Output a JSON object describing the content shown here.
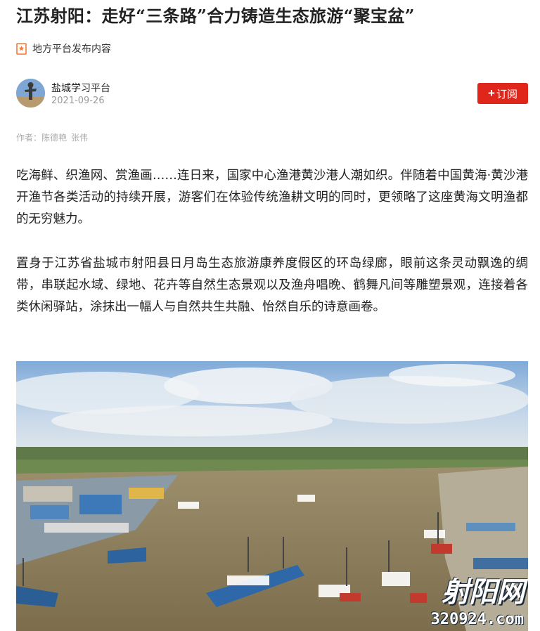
{
  "article": {
    "title": "江苏射阳：走好“三条路”合力铸造生态旅游“聚宝盆”",
    "source_label": "地方平台发布内容",
    "author": {
      "name": "盐城学习平台",
      "date": "2021-09-26",
      "subscribe_label": "订阅",
      "subscribe_plus": "+"
    },
    "byline": {
      "prefix": "作者：",
      "names": [
        "陈德艳",
        "张伟"
      ]
    },
    "paragraphs": [
      "吃海鲜、织渔网、赏渔画……连日来，国家中心渔港黄沙港人潮如织。伴随着中国黄海·黄沙港开渔节各类活动的持续开展，游客们在体验传统渔耕文明的同时，更领略了这座黄海文明渔都的无穷魅力。",
      "置身于江苏省盐城市射阳县日月岛生态旅游康养度假区的环岛绿廊，眼前这条灵动飘逸的绸带，串联起水域、绿地、花卉等自然生态景观以及渔舟唱晚、鹤舞凡间等雕塑景观，连接着各类休闲驿站，涂抹出一幅人与自然共生共融、怡然自乐的诗意画卷。"
    ],
    "photo": {
      "watermark_top": "射阳网",
      "watermark_bottom": "320924.com"
    }
  },
  "colors": {
    "accent": "#e0251b",
    "source_icon": "#f07a3a",
    "muted_text": "#999999"
  }
}
